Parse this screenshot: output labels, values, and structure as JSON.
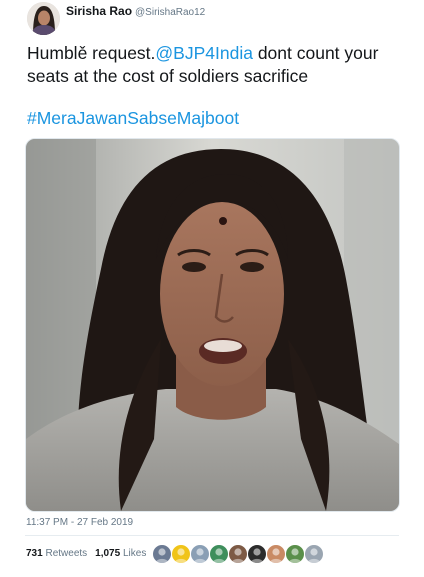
{
  "tweet": {
    "author": {
      "display_name": "Sirisha Rao",
      "handle": "@SirishaRao12",
      "avatar_icon": "profile-photo"
    },
    "text": {
      "before_mention": "Humblě request.",
      "mention": "@BJP4India",
      "after_mention": " dont count your seats at the cost of soldiers sacrifice"
    },
    "hashtag": "#MeraJawanSabseMajboot",
    "media": {
      "type": "video-still",
      "subject_icon": "woman-speaking-video-frame"
    },
    "timestamp": "11:37 PM - 27 Feb 2019",
    "stats": {
      "retweets_count": "731",
      "retweets_label": "Retweets",
      "likes_count": "1,075",
      "likes_label": "Likes"
    },
    "likers": [
      {
        "icon": "liker-avatar-1",
        "color": "#6b7a93"
      },
      {
        "icon": "liker-avatar-2",
        "color": "#f0c419"
      },
      {
        "icon": "liker-avatar-3",
        "color": "#8a9fb5"
      },
      {
        "icon": "liker-avatar-4",
        "color": "#3e8e5c"
      },
      {
        "icon": "liker-avatar-5",
        "color": "#7d5a45"
      },
      {
        "icon": "liker-avatar-6",
        "color": "#2c2c2c"
      },
      {
        "icon": "liker-avatar-7",
        "color": "#c98a64"
      },
      {
        "icon": "liker-avatar-8",
        "color": "#5a8f4a"
      },
      {
        "icon": "liker-avatar-9",
        "color": "#9aa5b1"
      }
    ]
  },
  "colors": {
    "link": "#1b95e0",
    "text": "#14171a",
    "muted": "#657786"
  }
}
